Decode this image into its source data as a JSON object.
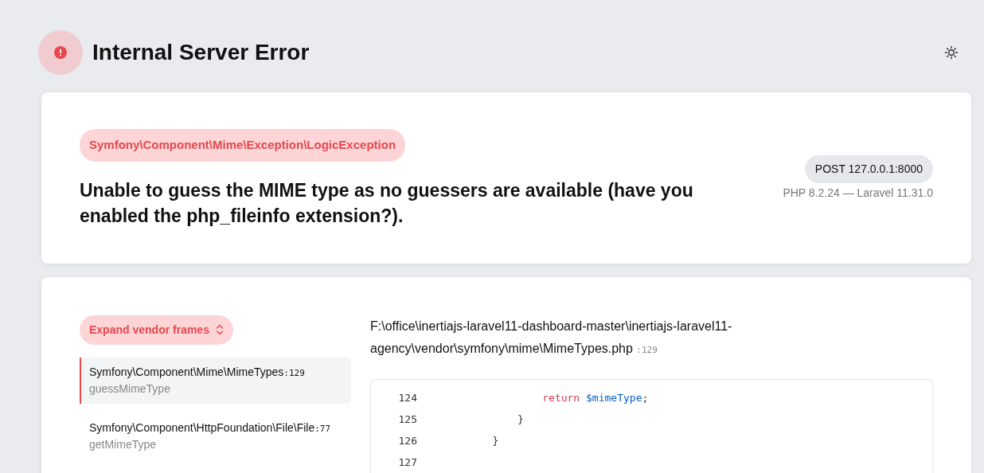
{
  "header": {
    "title": "Internal Server Error"
  },
  "exception": {
    "class": "Symfony\\Component\\Mime\\Exception\\LogicException",
    "message": "Unable to guess the MIME type as no guessers are available (have you enabled the php_fileinfo extension?).",
    "request": "POST 127.0.0.1:8000",
    "versions": "PHP 8.2.24 — Laravel 11.31.0"
  },
  "trace": {
    "expand_button": "Expand vendor frames",
    "frames": [
      {
        "class": "Symfony\\Component\\Mime\\MimeTypes",
        "line": ":129",
        "method": "guessMimeType",
        "selected": true
      },
      {
        "class": "Symfony\\Component\\HttpFoundation\\File\\File",
        "line": ":77",
        "method": "getMimeType",
        "selected": false
      }
    ],
    "file": {
      "path": "F:\\office\\inertiajs-laravel11-dashboard-master\\inertiajs-laravel11-agency\\vendor\\symfony\\mime\\MimeTypes.php",
      "line": ":129"
    },
    "code_lines": [
      {
        "number": "124",
        "tokens": [
          {
            "kind": "keyword",
            "text": "                return "
          },
          {
            "kind": "variable",
            "text": "$mimeType"
          },
          {
            "kind": "plain",
            "text": ";"
          }
        ]
      },
      {
        "number": "125",
        "tokens": [
          {
            "kind": "plain",
            "text": "            }"
          }
        ]
      },
      {
        "number": "126",
        "tokens": [
          {
            "kind": "plain",
            "text": "        }"
          }
        ]
      },
      {
        "number": "127"
      }
    ]
  }
}
